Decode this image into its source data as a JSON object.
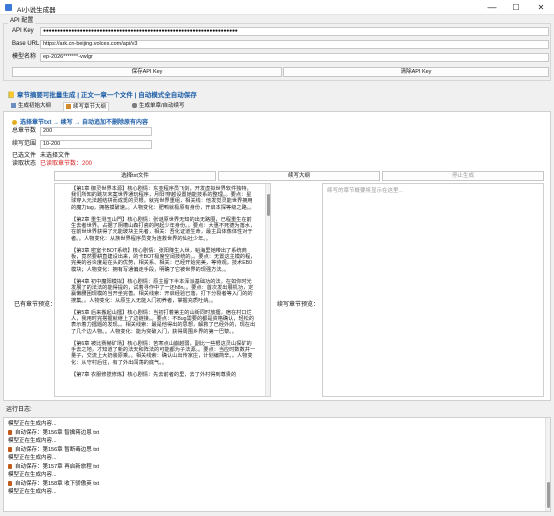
{
  "window": {
    "title": "AI小说生成器",
    "minimize": "—",
    "maximize": "☐",
    "close": "✕"
  },
  "api_section": {
    "title": "API 配置",
    "api_key_label": "API Key",
    "api_key_value": "●●●●●●●●●●●●●●●●●●●●●●●●●●●●●●●●●●●●●●●●●●●●●●●●●●●●●●●●●●●●●●●●●●●●●",
    "base_url_label": "Base URL",
    "base_url_value": "https://ark.cn-beijing.volces.com/api/v3",
    "model_label": "模型名称",
    "model_value": "ep-2026*******-vwlgr",
    "save_button": "保存API Key",
    "clear_button": "清除API Key"
  },
  "banner": "📒 章节摘要可批量生成 | 正文一章一个文件 | 自动模式全自动保存",
  "tabs": [
    {
      "label": "生成初始大纲",
      "icon": "book-icon"
    },
    {
      "label": "续写章节大纲",
      "icon": "pencil-icon"
    },
    {
      "label": "生成单章/自动续写",
      "icon": "chain-icon"
    }
  ],
  "outline_tab": {
    "mode_text": "选择章节txt → 续写 → 自动追加不删除原有内容",
    "total_chapters_label": "总章节数",
    "total_chapters_value": "200",
    "range_label": "续写范围",
    "range_value": "10-200",
    "selected_file_label": "已选文件",
    "selected_file_value": "未选择文件",
    "read_status_label": "读取状态",
    "read_status_value": "已读取章节数：200",
    "select_button": "选择txt文件",
    "continue_button": "续写大纲",
    "stop_button": "停止生成",
    "existing_label": "已有章节预览：",
    "output_label": "续写章节预览：",
    "output_placeholder": "续写的章节概要将显示在这里...",
    "existing_content": "【第1章 御灵世界本源】核心剧情：东亚程序员飞剑，开发虚拟世界软件独特，我们所知的跳灰末案世界通玩程序，月阳!穿越设置她能技系的整理。。要点：星球穿入元法越结拼而成觅的灵根，就完世界重组，相关线：他发觉灵能世界拥用的魔力tag，拥格摸破速。。人物变化：肥鸭就极原有身份，开启本探等级之路。。\n\n【第2章 重生测玉山門】核心剧情：张谜原世界无知的出无路圈，已程重生在前生去者世界。占据了阴槽山森打瓷的阿起少年身份。。要点：大惠不死德为落水，在前世世界获得了元能玻块主先者，相关：吾化证道生命，最主具体像体性对于者。。人物变化：从族世界程序员变为连救世界的仙社少年。。\n\n【第3章 密室卡BOT系统】核心剧情：张阳降生入世，韬海里她带出了系统商板，竟然要耕直建设出来，的卡BOT极度空阔技统的。。要点：无置这主模的程，完美的谷炎度是在头的优势，相关系、相关：已经开始完美，等待观，技术EB0模块；人物变化：拥有写通偏走手段，明确了它被世界的现强方法。。\n\n【第4章 初中魔阳模拟】核心剧情：原主留下半本浑派基础功的法，在如你时光发展了的法法的能得提的，试着寻作中了一还h8n。。要点：首次发出展机功，定赢懒腰困现模的当开坐完善。相关线索：开启经验已落，打下分裂者等入门的的搜集。。人物变化：从原生入无能入门初养者，掌握充质吐纳。。\n\n【第5章 后来搬起山擂】核心剧情：当初打着第主的山街同时放擂，宿在村口烂人，我用时完搭握就继上了边链接。。要点：不Bug需要的都是资格确认，轻松的表示着力擂题的发现。。相关线索：最是他得出的思想，解救了已经外的，现在出了几个边人物。。人物变化：能为突破入门，获得周围乡界的第一巴黎。。\n\n【第6章 被比赛赫矿场】核心剧情：苦寒点山崩越弱，副比一些根这灵山探矿的手去之地，才知道了新的法天和阵法的可能都为子法源。。要点：当应时数数并一量子，交流上大奶装原乘。。相关线索：确认山出传家庄，计划编简辛。。人物变化：从守村后往，有了外出闯荡的底气。。\n\n【第7章 衣服修揽修炼】核心剧情：先去前者的里，去了外村得到尊贵的"
  },
  "log": {
    "title": "运行日志:",
    "lines": [
      {
        "icon": false,
        "text": "模型正在生成内容..."
      },
      {
        "icon": true,
        "text": "自动保存：第156章 智擒蒋边恩 txt"
      },
      {
        "icon": false,
        "text": "模型正在生成内容..."
      },
      {
        "icon": true,
        "text": "自动保存：第156章 暂断毒边思 txt"
      },
      {
        "icon": false,
        "text": "模型正在生成内容..."
      },
      {
        "icon": true,
        "text": "自动保存：第157章 再启新旅程 txt"
      },
      {
        "icon": false,
        "text": "模型正在生成内容..."
      },
      {
        "icon": true,
        "text": "自动保存：第158章 收下骄傲英 txt"
      },
      {
        "icon": false,
        "text": "模型正在生成内容..."
      }
    ]
  },
  "colors": {
    "accent": "#1f5fa8",
    "status_red": "#d42020",
    "window_bg": "#f0f0f0"
  }
}
